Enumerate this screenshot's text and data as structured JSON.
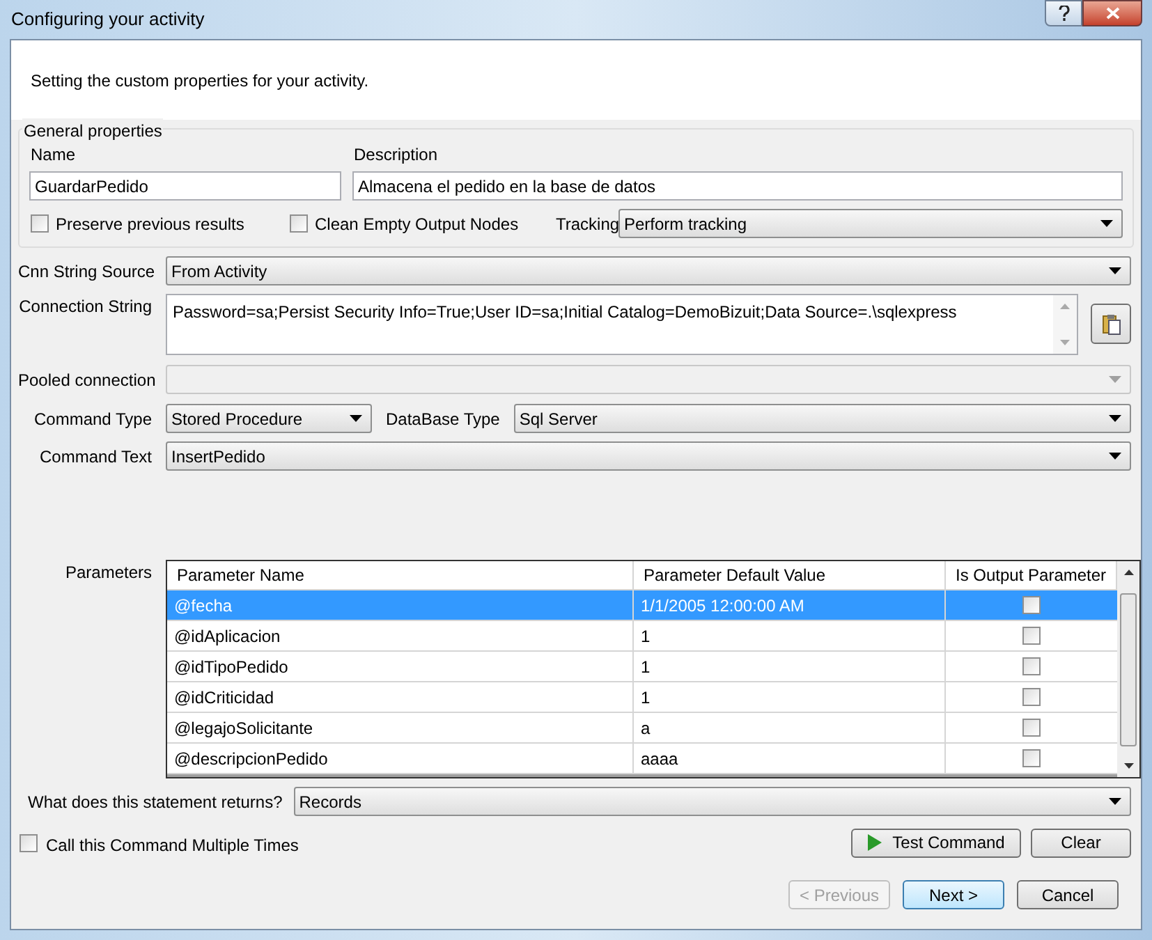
{
  "window": {
    "title": "Configuring your activity"
  },
  "header": {
    "text": "Setting the custom properties for your activity."
  },
  "general_properties": {
    "title": "General properties",
    "name": {
      "label": "Name",
      "value": "GuardarPedido"
    },
    "description": {
      "label": "Description",
      "value": "Almacena el pedido en la base de datos"
    },
    "checkboxes": [
      {
        "label": "Preserve previous results",
        "checked": false
      },
      {
        "label": "Clean Empty Output Nodes",
        "checked": false
      }
    ],
    "tracking": {
      "label": "Tracking",
      "value": "Perform tracking"
    }
  },
  "cnn_string_source": {
    "label": "Cnn String Source",
    "value": "From Activity"
  },
  "connection_string": {
    "label": "Connection String",
    "value": "Password=sa;Persist Security Info=True;User ID=sa;Initial Catalog=DemoBizuit;Data Source=.\\sqlexpress"
  },
  "pooled_connection": {
    "label": "Pooled connection",
    "disabled": true
  },
  "command_type": {
    "label": "Command Type",
    "value": "Stored Procedure"
  },
  "database_type": {
    "label": "DataBase Type",
    "value": "Sql Server"
  },
  "command_text": {
    "label": "Command Text",
    "value": "InsertPedido"
  },
  "parameters": {
    "label": "Parameters",
    "columns": [
      "Parameter Name",
      "Parameter Default Value",
      "Is Output Parameter"
    ],
    "rows": [
      {
        "name": "@fecha",
        "value": "1/1/2005 12:00:00 AM",
        "is_output": false,
        "selected": true
      },
      {
        "name": "@idAplicacion",
        "value": "1",
        "is_output": false,
        "selected": false
      },
      {
        "name": "@idTipoPedido",
        "value": "1",
        "is_output": false,
        "selected": false
      },
      {
        "name": "@idCriticidad",
        "value": "1",
        "is_output": false,
        "selected": false
      },
      {
        "name": "@legajoSolicitante",
        "value": "a",
        "is_output": false,
        "selected": false
      },
      {
        "name": "@descripcionPedido",
        "value": "aaaa",
        "is_output": false,
        "selected": false
      }
    ]
  },
  "returns": {
    "label": "What does this statement returns?",
    "value": "Records"
  },
  "multiple_times": {
    "label": "Call this Command Multiple Times",
    "checked": false
  },
  "buttons": {
    "test_command": "Test Command",
    "clear": "Clear",
    "previous": {
      "label": "< Previous",
      "disabled": true
    },
    "next": {
      "label": "Next >",
      "default": true
    },
    "cancel": {
      "label": "Cancel",
      "disabled": false
    }
  }
}
